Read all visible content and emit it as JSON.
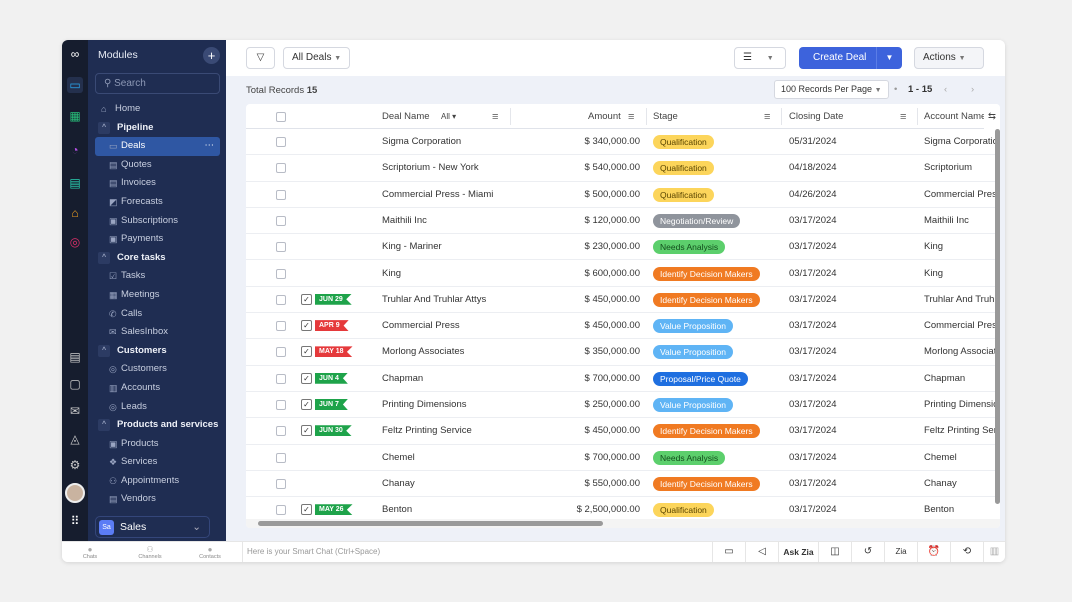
{
  "sidebar": {
    "title": "Modules",
    "search_placeholder": "Search",
    "items": [
      {
        "label": "Home",
        "icon": "⌂",
        "type": "top"
      },
      {
        "label": "Pipeline",
        "icon": "^",
        "type": "sec"
      },
      {
        "label": "Deals",
        "icon": "▭",
        "type": "act"
      },
      {
        "label": "Quotes",
        "icon": "▤",
        "type": ""
      },
      {
        "label": "Invoices",
        "icon": "▤",
        "type": ""
      },
      {
        "label": "Forecasts",
        "icon": "◩",
        "type": ""
      },
      {
        "label": "Subscriptions",
        "icon": "▣",
        "type": ""
      },
      {
        "label": "Payments",
        "icon": "▣",
        "type": ""
      },
      {
        "label": "Core tasks",
        "icon": "^",
        "type": "sec"
      },
      {
        "label": "Tasks",
        "icon": "☑",
        "type": ""
      },
      {
        "label": "Meetings",
        "icon": "▦",
        "type": ""
      },
      {
        "label": "Calls",
        "icon": "✆",
        "type": ""
      },
      {
        "label": "SalesInbox",
        "icon": "✉",
        "type": ""
      },
      {
        "label": "Customers",
        "icon": "^",
        "type": "sec"
      },
      {
        "label": "Customers",
        "icon": "◎",
        "type": ""
      },
      {
        "label": "Accounts",
        "icon": "▥",
        "type": ""
      },
      {
        "label": "Leads",
        "icon": "◎",
        "type": ""
      },
      {
        "label": "Products and services",
        "icon": "^",
        "type": "sec"
      },
      {
        "label": "Products",
        "icon": "▣",
        "type": ""
      },
      {
        "label": "Services",
        "icon": "❖",
        "type": ""
      },
      {
        "label": "Appointments",
        "icon": "⚇",
        "type": ""
      },
      {
        "label": "Vendors",
        "icon": "▤",
        "type": ""
      }
    ],
    "workspace": {
      "badge": "Sa",
      "label": "Sales"
    }
  },
  "toolbar": {
    "view": "All Deals",
    "create": "Create Deal",
    "actions": "Actions"
  },
  "summary": {
    "total_label": "Total Records",
    "total": "15",
    "per_page": "100 Records Per Page",
    "range": "1 - 15"
  },
  "table": {
    "headers": {
      "name": "Deal Name",
      "filter": "All",
      "amount": "Amount",
      "stage": "Stage",
      "date": "Closing Date",
      "account": "Account Name"
    },
    "rows": [
      {
        "name": "Sigma Corporation",
        "amount": "$ 340,000.00",
        "stage": "Qualification",
        "date": "05/31/2024",
        "account": "Sigma Corporation",
        "flag": null
      },
      {
        "name": "Scriptorium - New York",
        "amount": "$ 540,000.00",
        "stage": "Qualification",
        "date": "04/18/2024",
        "account": "Scriptorium",
        "flag": null
      },
      {
        "name": "Commercial Press - Miami",
        "amount": "$ 500,000.00",
        "stage": "Qualification",
        "date": "04/26/2024",
        "account": "Commercial Press",
        "flag": null
      },
      {
        "name": "Maithili Inc",
        "amount": "$ 120,000.00",
        "stage": "Negotiation/Review",
        "date": "03/17/2024",
        "account": "Maithili Inc",
        "flag": null
      },
      {
        "name": "King - Mariner",
        "amount": "$ 230,000.00",
        "stage": "Needs Analysis",
        "date": "03/17/2024",
        "account": "King",
        "flag": null
      },
      {
        "name": "King",
        "amount": "$ 600,000.00",
        "stage": "Identify Decision Makers",
        "date": "03/17/2024",
        "account": "King",
        "flag": null
      },
      {
        "name": "Truhlar And Truhlar Attys",
        "amount": "$ 450,000.00",
        "stage": "Identify Decision Makers",
        "date": "03/17/2024",
        "account": "Truhlar And Truhlar",
        "flag": "JUN 29",
        "flag_color": "#1ea34a"
      },
      {
        "name": "Commercial Press",
        "amount": "$ 450,000.00",
        "stage": "Value Proposition",
        "date": "03/17/2024",
        "account": "Commercial Press",
        "flag": "APR 9",
        "flag_color": "#e5393b"
      },
      {
        "name": "Morlong Associates",
        "amount": "$ 350,000.00",
        "stage": "Value Proposition",
        "date": "03/17/2024",
        "account": "Morlong Associates",
        "flag": "MAY 18",
        "flag_color": "#e5393b"
      },
      {
        "name": "Chapman",
        "amount": "$ 700,000.00",
        "stage": "Proposal/Price Quote",
        "date": "03/17/2024",
        "account": "Chapman",
        "flag": "JUN 4",
        "flag_color": "#1ea34a"
      },
      {
        "name": "Printing Dimensions",
        "amount": "$ 250,000.00",
        "stage": "Value Proposition",
        "date": "03/17/2024",
        "account": "Printing Dimensions",
        "flag": "JUN 7",
        "flag_color": "#1ea34a"
      },
      {
        "name": "Feltz Printing Service",
        "amount": "$ 450,000.00",
        "stage": "Identify Decision Makers",
        "date": "03/17/2024",
        "account": "Feltz Printing Service",
        "flag": "JUN 30",
        "flag_color": "#1ea34a"
      },
      {
        "name": "Chemel",
        "amount": "$ 700,000.00",
        "stage": "Needs Analysis",
        "date": "03/17/2024",
        "account": "Chemel",
        "flag": null
      },
      {
        "name": "Chanay",
        "amount": "$ 550,000.00",
        "stage": "Identify Decision Makers",
        "date": "03/17/2024",
        "account": "Chanay",
        "flag": null
      },
      {
        "name": "Benton",
        "amount": "$ 2,500,000.00",
        "stage": "Qualification",
        "date": "03/17/2024",
        "account": "Benton",
        "flag": "MAY 26",
        "flag_color": "#1ea34a"
      }
    ]
  },
  "stage_colors": {
    "Qualification": [
      "#fcd55b",
      "#5a4500"
    ],
    "Negotiation/Review": [
      "#8f949c",
      "#fff"
    ],
    "Needs Analysis": [
      "#5ccf6c",
      "#124d1c"
    ],
    "Identify Decision Makers": [
      "#f07a22",
      "#fff"
    ],
    "Value Proposition": [
      "#5fb4f5",
      "#fff"
    ],
    "Proposal/Price Quote": [
      "#1f6fe0",
      "#fff"
    ]
  },
  "bottom": {
    "chats": "Chats",
    "channels": "Channels",
    "contacts": "Contacts",
    "smart_chat": "Here is your Smart Chat (Ctrl+Space)",
    "ask_zia": "Ask Zia"
  }
}
